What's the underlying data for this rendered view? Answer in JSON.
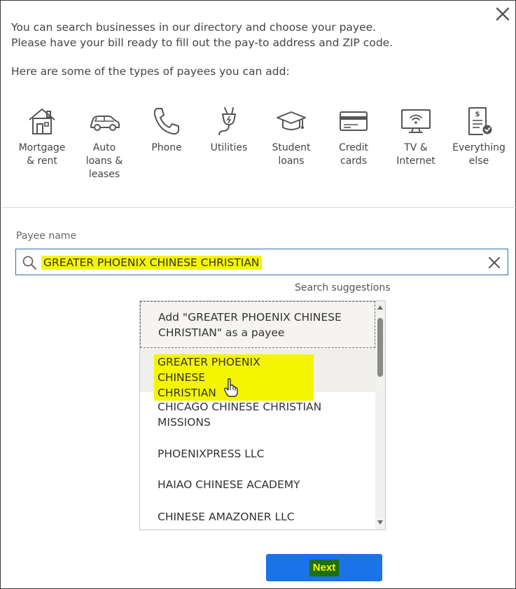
{
  "intro": {
    "line1": "You can search businesses in our directory and choose your payee.",
    "line2": "Please have your bill ready to fill out the pay-to address and ZIP code."
  },
  "types_title": "Here are some of the types of payees you can add:",
  "payee_types": [
    {
      "line1": "Mortgage",
      "line2": "& rent",
      "line3": "",
      "icon": "house-icon"
    },
    {
      "line1": "Auto",
      "line2": "loans &",
      "line3": "leases",
      "icon": "car-icon"
    },
    {
      "line1": "Phone",
      "line2": "",
      "line3": "",
      "icon": "phone-icon"
    },
    {
      "line1": "Utilities",
      "line2": "",
      "line3": "",
      "icon": "plug-icon"
    },
    {
      "line1": "Student",
      "line2": "loans",
      "line3": "",
      "icon": "graduation-cap-icon"
    },
    {
      "line1": "Credit",
      "line2": "cards",
      "line3": "",
      "icon": "credit-card-icon"
    },
    {
      "line1": "TV &",
      "line2": "Internet",
      "line3": "",
      "icon": "monitor-wifi-icon"
    },
    {
      "line1": "Everything",
      "line2": "else",
      "line3": "",
      "icon": "document-check-icon"
    }
  ],
  "payee_field": {
    "label": "Payee name",
    "value": "GREATER PHOENIX CHINESE CHRISTIAN"
  },
  "suggestions": {
    "title": "Search suggestions",
    "add_line1": "Add \"GREATER PHOENIX CHINESE",
    "add_line2": "CHRISTIAN\" as a payee",
    "items": [
      {
        "line1": "GREATER PHOENIX CHINESE",
        "line2": "CHRISTIAN"
      },
      {
        "line1": "CHICAGO CHINESE CHRISTIAN",
        "line2": "MISSIONS"
      },
      {
        "line1": "PHOENIXPRESS LLC",
        "line2": ""
      },
      {
        "line1": "HAIAO CHINESE ACADEMY",
        "line2": ""
      },
      {
        "line1": "CHINESE AMAZONER LLC",
        "line2": ""
      }
    ]
  },
  "next_label": "Next",
  "colors": {
    "accent": "#1a73e8",
    "highlight": "#f5f500",
    "next_label_bg": "#1e6e14",
    "search_border": "#2a6fb6"
  }
}
